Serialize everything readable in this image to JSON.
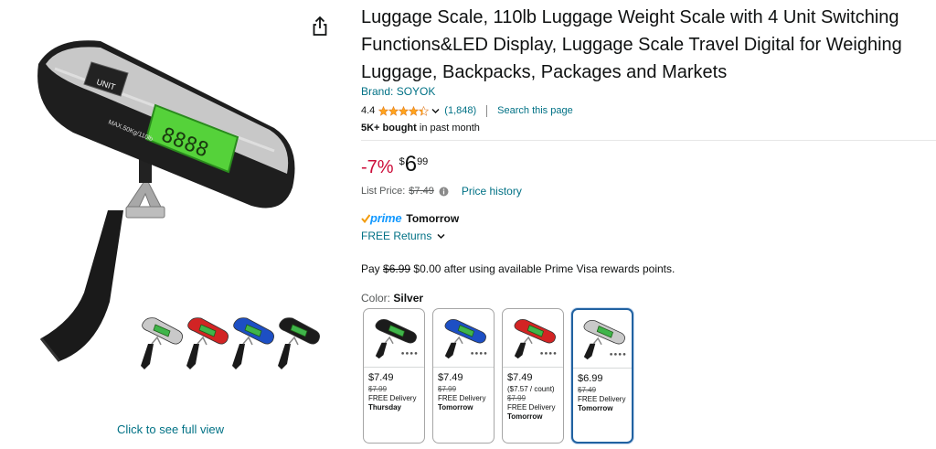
{
  "title": "Luggage Scale, 110lb Luggage Weight Scale with 4 Unit Switching Functions&LED Display, Luggage Scale Travel Digital for Weighing Luggage, Backpacks, Packages and Markets",
  "brand": "Brand: SOYOK",
  "rating": {
    "value": "4.4",
    "stars": 4.4,
    "count": "(1,848)",
    "search_link": "Search this page"
  },
  "bought": {
    "bold": "5K+ bought",
    "rest": "in past month"
  },
  "price": {
    "discount": "-7%",
    "currency": "$",
    "whole": "6",
    "fraction": "99",
    "list_label": "List Price:",
    "list_value": "$7.49",
    "history": "Price history"
  },
  "delivery": {
    "prime": "prime",
    "when": "Tomorrow",
    "returns": "FREE Returns"
  },
  "promo": {
    "pay": "Pay",
    "strike": "$6.99",
    "rest": "$0.00 after using available Prime Visa rewards points."
  },
  "color": {
    "label": "Color:",
    "selected": "Silver"
  },
  "swatches": [
    {
      "price": "$7.49",
      "unit": "",
      "strike": "$7.99",
      "delivery": "FREE Delivery",
      "day": "Thursday",
      "color": "#1b1b1b",
      "screen": "#3fb54a"
    },
    {
      "price": "$7.49",
      "unit": "",
      "strike": "$7.99",
      "delivery": "FREE Delivery",
      "day": "Tomorrow",
      "color": "#1d4fc4",
      "screen": "#3fb54a"
    },
    {
      "price": "$7.49",
      "unit": "($7.57 / count)",
      "strike": "$7.99",
      "delivery": "FREE Delivery",
      "day": "Tomorrow",
      "color": "#d22424",
      "screen": "#3fb54a"
    },
    {
      "price": "$6.99",
      "unit": "",
      "strike": "$7.49",
      "delivery": "FREE Delivery",
      "day": "Tomorrow",
      "color": "#c9c9c9",
      "screen": "#3fb54a"
    }
  ],
  "image": {
    "full_view": "Click to see full view",
    "thumb_colors": [
      "#c9c9c9",
      "#d22424",
      "#1d4fc4",
      "#1b1b1b"
    ]
  },
  "colors": {
    "link": "#007185",
    "discount": "#cc0c39",
    "star": "#ffa41c",
    "prime": "#1399ff",
    "selected_border": "#2162a1"
  }
}
